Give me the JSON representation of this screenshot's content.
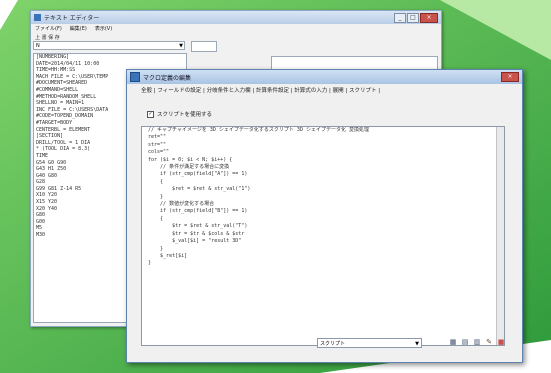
{
  "colors": {
    "green_dark": "#2e9a3b",
    "green_light": "#7fd36a",
    "dialog_border": "#5f83b0",
    "close_button": "#c9524a"
  },
  "back_window": {
    "title": "テキスト エディター",
    "menu": [
      "ファイル(F)",
      "編集(E)",
      "表示(V)"
    ],
    "toolbar": "上 書 保 存",
    "select_value": "N",
    "list_items": [
      "[NUMBERING]",
      "DATE=2014/04/11 10:00",
      "TIME=HH:MM:SS",
      "MACH FILE = C:\\USER\\TEMP",
      "#DOCUMENT=SHEARED",
      "#COMMAND=SHELL",
      "#METHOD=RANDOM_SHELL",
      "SHELLNO = MAIN=1",
      "INC FILE = C:\\USERS\\DATA",
      "#CODE=TOPEND_DOMAIN",
      "#TARGET=BODY",
      "CENTERBL = ELEMENT",
      "",
      "[SECTION]",
      "DRILL/TOOL = 1 DIA",
      "* (TOOL DIA = 8.3)",
      "TIME",
      "G54 G0 G90",
      "G43 H1 Z50",
      "G40 G80",
      "G28",
      "G99 G81 Z-14 R5",
      "X10 Y20",
      "X15 Y20",
      "X20 Y40",
      "G80",
      "G00",
      "M5",
      "M30"
    ]
  },
  "dialog": {
    "title": "マクロ定義の編集",
    "tabs_label": "全般 | フィールドの設定 | 分岐条件と入力欄 | 計算条件設定 | 計算式の入力 | 展開 | スクリプト |",
    "checkbox_label": "スクリプトを使用する",
    "checkbox_state": "checked",
    "code_lines": [
      "// キャプチャイメージを 3D シェイプデータ化するスクリプト 3D シェイプデータ化 変換処理",
      "",
      "ret=\"\"",
      "str=\"\"",
      "cols=\"\"",
      "",
      "for ($i = 0; $i < N; $i++) {",
      "",
      "    // 条件が満足する場合に変換",
      "    if (str_cmp(field[\"A\"]) == 1)",
      "    {",
      "        $ret = $ret & str_val(\"1\")",
      "    }",
      "",
      "    // 数値が変化する場合",
      "    if (str_cmp(field[\"B\"]) == 1)",
      "    {",
      "        $tr = $ret & str_val(\"T\")",
      "        $tr = $tr & $cols & $str",
      "        $_val[$i] = \"result 3D\"",
      "    }",
      "",
      "    $_ret[$i]",
      "}"
    ],
    "bottom_select_value": "スクリプト"
  }
}
